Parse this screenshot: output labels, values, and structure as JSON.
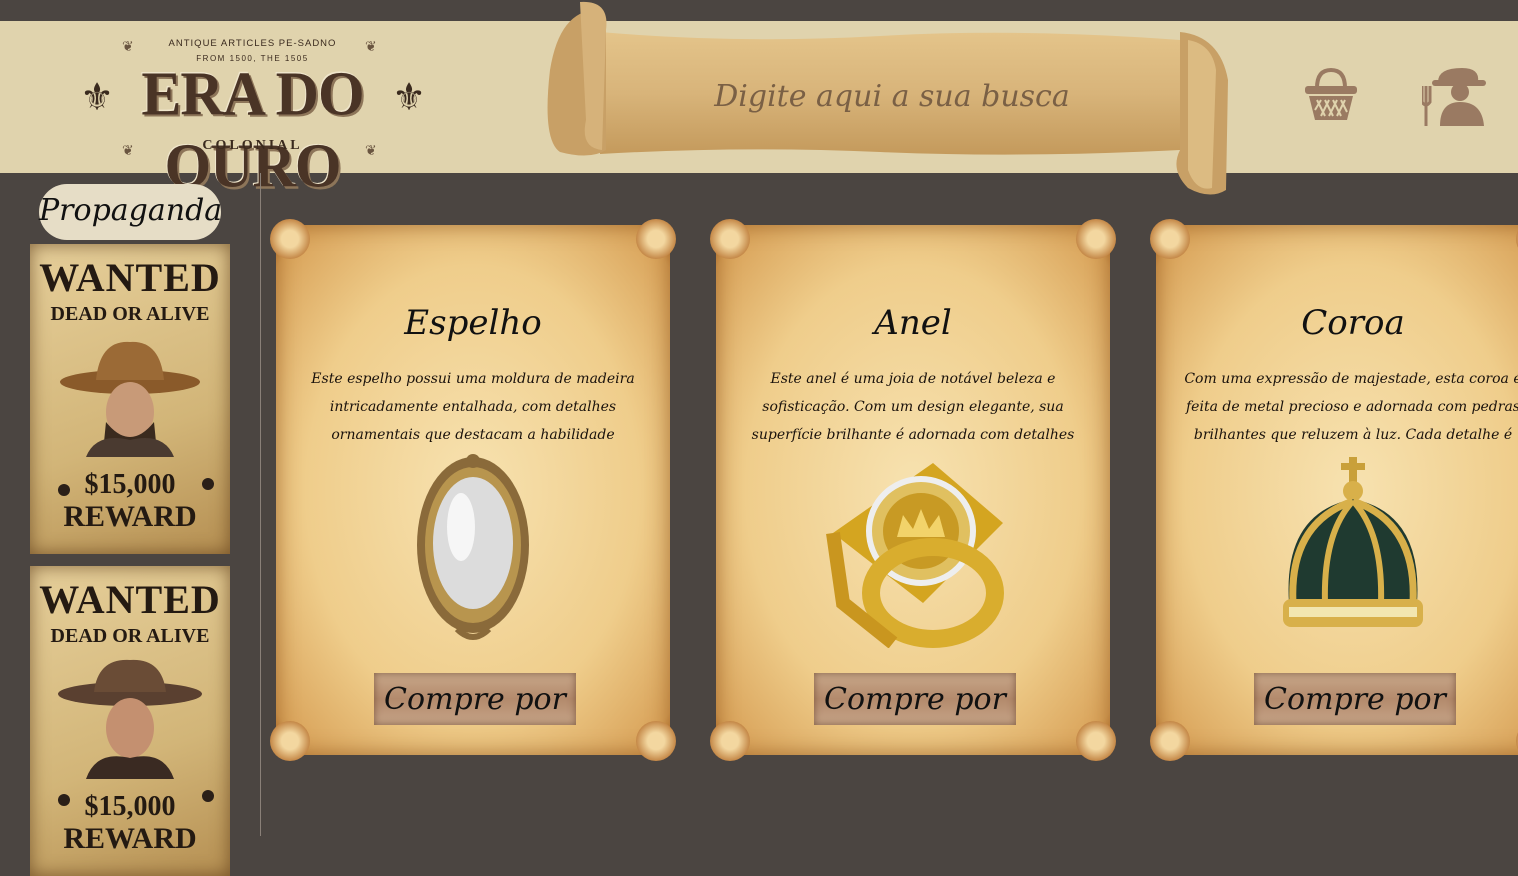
{
  "header": {
    "logo": {
      "tagline_top": "ANTIQUE ARTICLES PE-SADNO",
      "tagline_sub": "FROM 1500, THE 1505",
      "name": "ERA DO OURO",
      "subtitle": "COLONIAL"
    },
    "search": {
      "placeholder": "Digite aqui a sua busca"
    },
    "icons": [
      "basket-icon",
      "farmer-user-icon"
    ]
  },
  "sidebar": {
    "title": "Propaganda",
    "ads": [
      {
        "line1": "WANTED",
        "line2": "DEAD OR ALIVE",
        "amount": "$15,000",
        "reward": "REWARD"
      },
      {
        "line1": "WANTED",
        "line2": "DEAD OR ALIVE",
        "amount": "$15,000",
        "reward": "REWARD"
      }
    ]
  },
  "products": [
    {
      "title": "Espelho",
      "description": "Este espelho possui uma moldura de madeira intricadamente entalhada, com detalhes ornamentais que destacam a habilidade artesanal. O vidro polido",
      "button": "Compre por",
      "image": "mirror"
    },
    {
      "title": "Anel",
      "description": "Este anel é uma joia de notável beleza e sofisticação. Com um design elegante, sua superfície brilhante é adornada com detalhes intricados que capturam a luz de",
      "button": "Compre por",
      "image": "gold-ring"
    },
    {
      "title": "Coroa",
      "description": "Com uma expressão de majestade, esta coroa é feita de metal precioso e adornada com pedras brilhantes que reluzem à luz. Cada detalhe é cuidadosamente",
      "button": "Compre por",
      "image": "crown"
    }
  ],
  "colors": {
    "page_background": "#4b4541",
    "header_background": "#e0d3ad",
    "parchment": "#efcd8b",
    "button": "#b38a6c"
  }
}
